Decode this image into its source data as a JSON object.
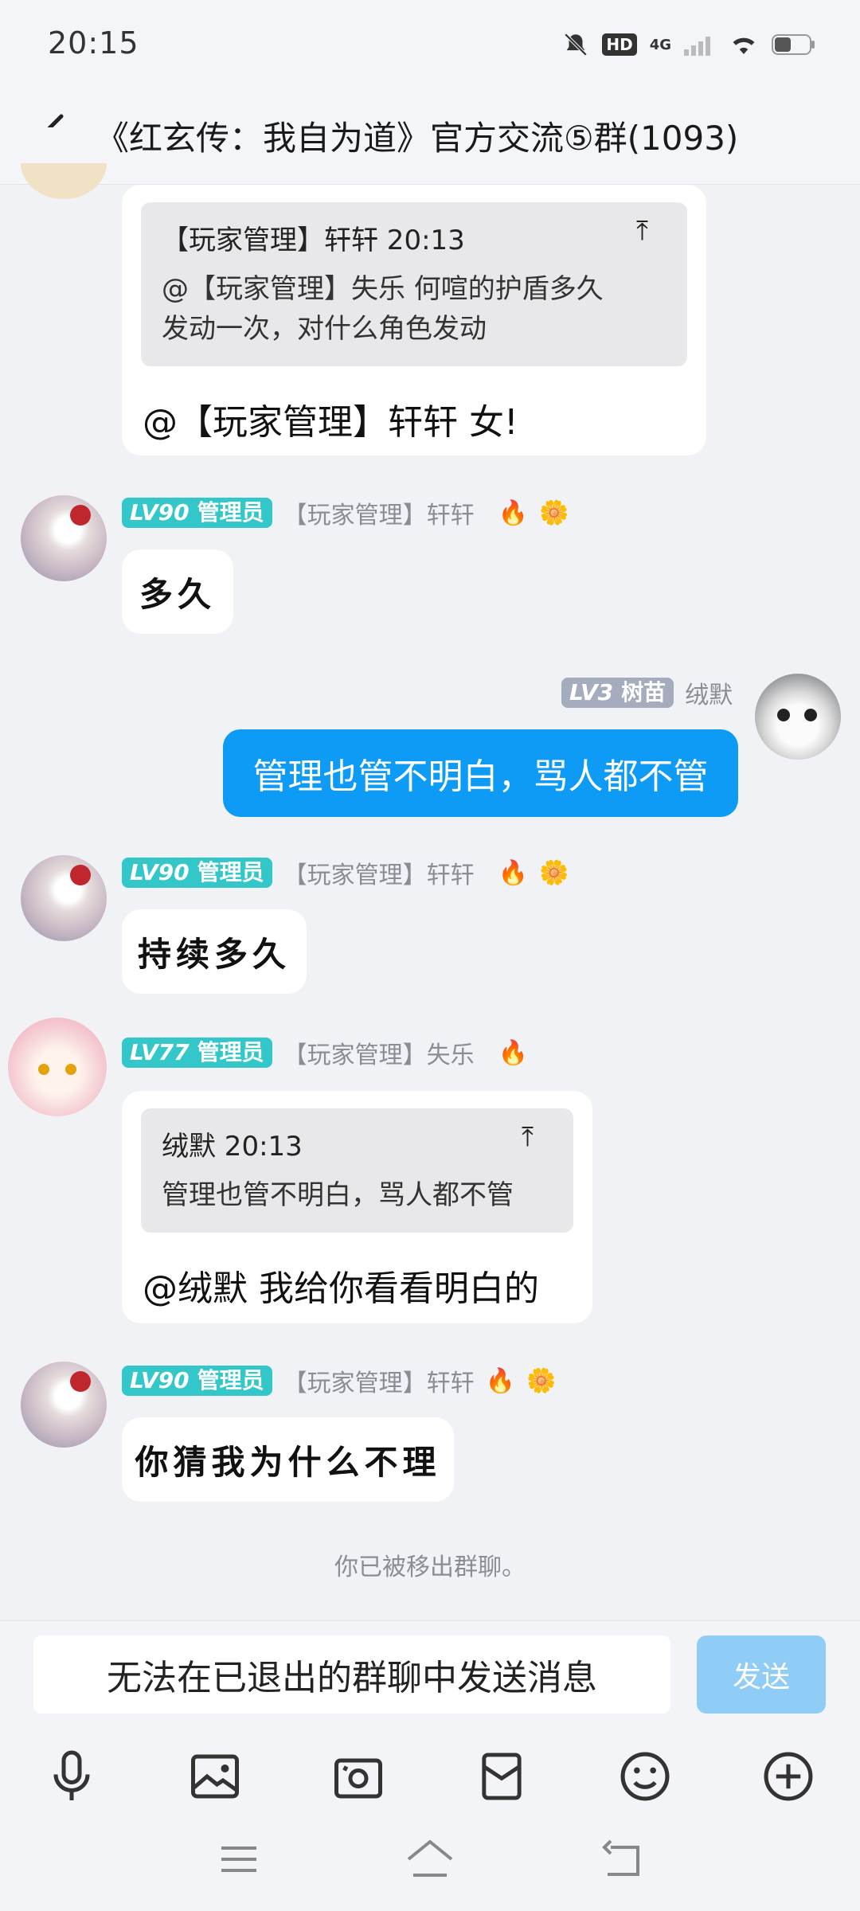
{
  "status_bar": {
    "time": "20:15",
    "network": "4G",
    "hd": "HD"
  },
  "header": {
    "title": "《红玄传：我自为道》官方交流⑤群(1093)"
  },
  "messages": [
    {
      "quote": {
        "author": "【玩家管理】轩轩 20:13",
        "body_line1": "@【玩家管理】失乐 何喧的护盾多久",
        "body_line2": "发动一次，对什么角色发动"
      },
      "text": "@【玩家管理】轩轩 女!"
    },
    {
      "level": "LV90",
      "role": "管理员",
      "sender": "【玩家管理】轩轩",
      "text": "多久"
    },
    {
      "level": "LV3",
      "role": "树苗",
      "sender": "绒默",
      "text": "管理也管不明白，骂人都不管"
    },
    {
      "level": "LV90",
      "role": "管理员",
      "sender": "【玩家管理】轩轩",
      "text": "持续多久"
    },
    {
      "level": "LV77",
      "role": "管理员",
      "sender": "【玩家管理】失乐",
      "quote": {
        "author": "绒默 20:13",
        "body_line1": "管理也管不明白，骂人都不管"
      },
      "text": "@绒默 我给你看看明白的"
    },
    {
      "level": "LV90",
      "role": "管理员",
      "sender": "【玩家管理】轩轩",
      "text": "你猜我为什么不理"
    }
  ],
  "system_note": "你已被移出群聊。",
  "input": {
    "placeholder": "无法在已退出的群聊中发送消息",
    "send_label": "发送"
  },
  "colors": {
    "sent_bubble": "#0d9bf5",
    "level_badge": "#33c7c9",
    "send_disabled": "#8fcdf7",
    "background": "#f1f2f6"
  },
  "toolbar_icons": [
    "microphone-icon",
    "image-icon",
    "camera-icon",
    "red-packet-icon",
    "emoji-icon",
    "plus-icon"
  ],
  "nav_icons": [
    "menu-icon",
    "home-icon",
    "back-nav-icon"
  ]
}
